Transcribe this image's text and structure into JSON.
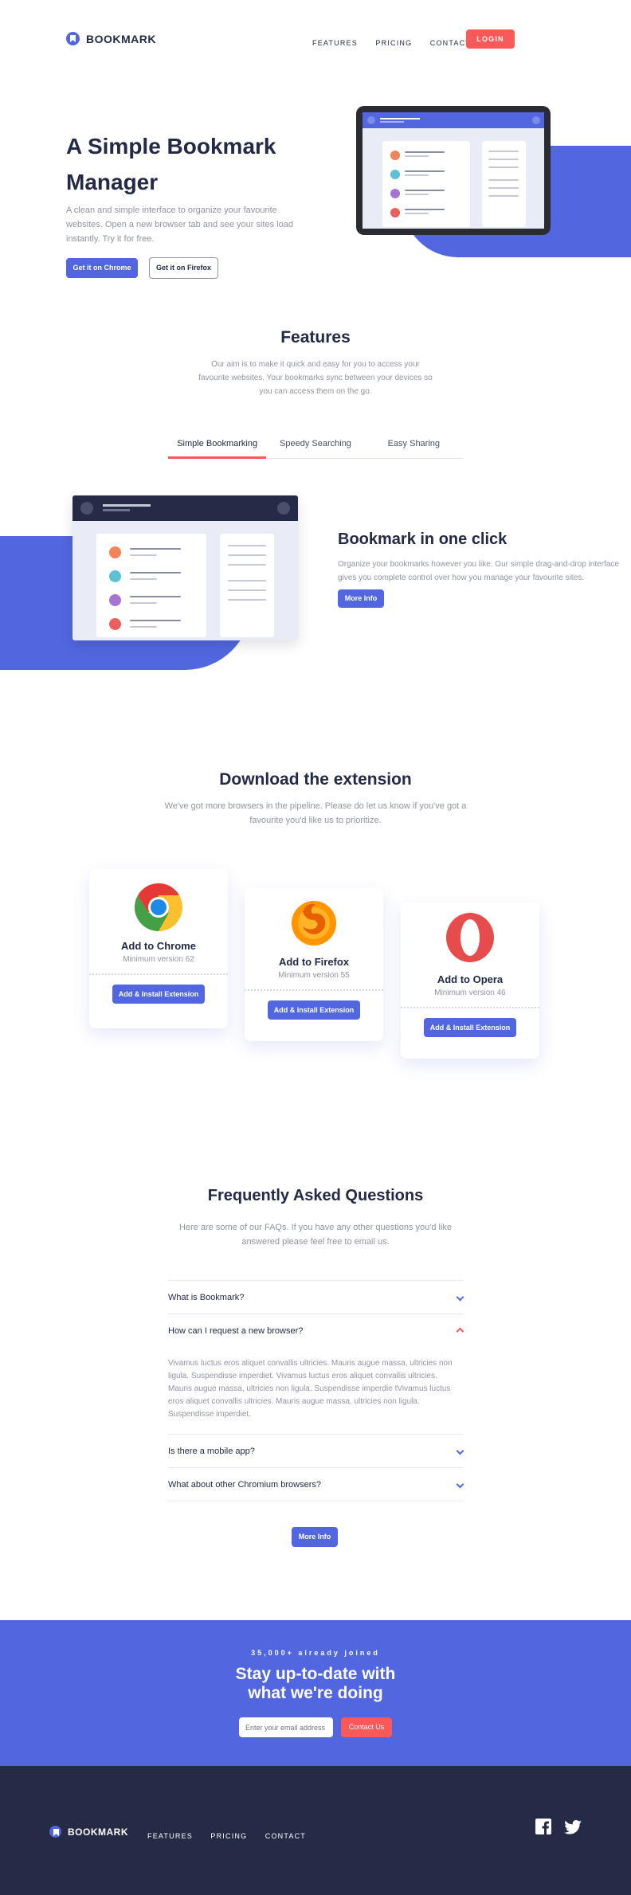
{
  "header": {
    "logo": "BOOKMARK",
    "nav": [
      "FEATURES",
      "PRICING",
      "CONTACT"
    ],
    "login": "LOGIN"
  },
  "hero": {
    "title_line1": "A Simple Bookmark",
    "title_line2": "Manager",
    "text": "A clean and simple interface to organize your favourite websites. Open a new browser tab and see your sites load instantly. Try it for free.",
    "btn_chrome": "Get it on Chrome",
    "btn_firefox": "Get it on Firefox"
  },
  "features": {
    "title": "Features",
    "text": "Our aim is to make it quick and easy for you to access your favourite websites. Your bookmarks sync between your devices so you can access them on the go.",
    "tabs": [
      "Simple Bookmarking",
      "Speedy Searching",
      "Easy Sharing"
    ],
    "active_tab": "Simple Bookmarking",
    "panel_title": "Bookmark in one click",
    "panel_text": "Organize your bookmarks however you like. Our simple drag-and-drop interface gives you complete control over how you manage your favourite sites.",
    "panel_button": "More Info"
  },
  "download": {
    "title": "Download the extension",
    "text": "We've got more browsers in the pipeline. Please do let us know if you've got a favourite you'd like us to prioritize.",
    "cards": [
      {
        "title": "Add to Chrome",
        "version": "Minimum version 62",
        "button": "Add & Install Extension",
        "icon": "chrome-icon"
      },
      {
        "title": "Add to Firefox",
        "version": "Minimum version 55",
        "button": "Add & Install Extension",
        "icon": "firefox-icon"
      },
      {
        "title": "Add to Opera",
        "version": "Minimum version 46",
        "button": "Add & Install Extension",
        "icon": "opera-icon"
      }
    ]
  },
  "faq": {
    "title": "Frequently Asked Questions",
    "text": "Here are some of our FAQs. If you have any other questions you'd like answered please feel free to email us.",
    "questions": [
      "What is Bookmark?",
      "How can I request a new browser?",
      "Is there a mobile app?",
      "What about other Chromium browsers?"
    ],
    "open_index": 1,
    "answer": "Vivamus luctus eros aliquet convallis ultricies. Mauris augue massa, ultricies non ligula. Suspendisse imperdiet. Vivamus luctus eros aliquet convallis ultricies. Mauris augue massa, ultricies non ligula. Suspendisse imperdie tVivamus luctus eros aliquet convallis ultricies. Mauris augue massa, ultricies non ligula. Suspendisse imperdiet.",
    "button": "More Info"
  },
  "cta": {
    "eyebrow": "35,000+ already joined",
    "title_line1": "Stay up-to-date with",
    "title_line2": "what we're doing",
    "placeholder": "Enter your email address",
    "button": "Contact Us"
  },
  "footer": {
    "logo": "BOOKMARK",
    "nav": [
      "FEATURES",
      "PRICING",
      "CONTACT"
    ],
    "social": [
      "facebook-icon",
      "twitter-icon"
    ]
  },
  "colors": {
    "blue": "#5267df",
    "red": "#fa5959",
    "navy": "#252b46",
    "grey": "#9194a1"
  }
}
